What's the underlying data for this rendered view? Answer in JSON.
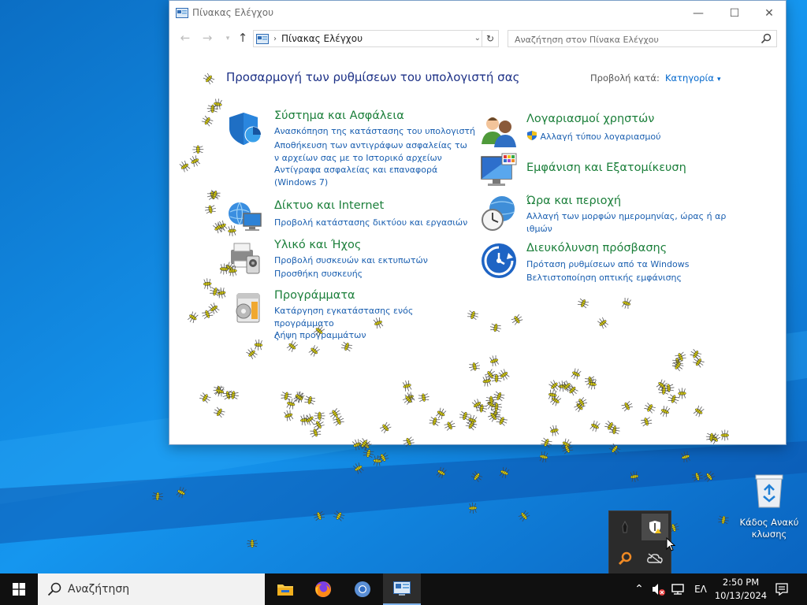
{
  "window": {
    "title": "Πίνακας Ελέγχου",
    "minimize": "—",
    "maximize": "☐",
    "close": "✕"
  },
  "nav": {
    "back": "←",
    "forward": "→",
    "recent": "▾",
    "up": "↑",
    "address_separator": "›",
    "address_text": "Πίνακας Ελέγχου",
    "address_dropdown": "⌄",
    "refresh": "↻",
    "search_placeholder": "Αναζήτηση στον Πίνακα Ελέγχου"
  },
  "content": {
    "heading": "Προσαρμογή των ρυθμίσεων του υπολογιστή σας",
    "view_by_label": "Προβολή κατά:",
    "view_by_value": "Κατηγορία",
    "view_by_caret": "▾"
  },
  "categories_left": [
    {
      "title": "Σύστημα και Ασφάλεια",
      "icon": "shield-icon",
      "links": [
        "Ανασκόπηση της κατάστασης του υπολογιστή",
        "Αποθήκευση των αντιγράφων ασφαλείας τω\nν αρχείων σας με το Ιστορικό αρχείων",
        "Αντίγραφα ασφαλείας και επαναφορά\n(Windows 7)"
      ]
    },
    {
      "title": "Δίκτυο και Internet",
      "icon": "network-icon",
      "links": [
        "Προβολή κατάστασης δικτύου και εργασιών"
      ]
    },
    {
      "title": "Υλικό και Ήχος",
      "icon": "printer-icon",
      "links": [
        "Προβολή συσκευών και εκτυπωτών",
        "Προσθήκη συσκευής"
      ]
    },
    {
      "title": "Προγράμματα",
      "icon": "programs-icon",
      "links": [
        "Κατάργηση εγκατάστασης ενός προγράμματο\nς",
        "Λήψη προγραμμάτων"
      ]
    }
  ],
  "categories_right": [
    {
      "title": "Λογαριασμοί χρηστών",
      "icon": "users-icon",
      "links": [
        "Αλλαγή τύπου λογαριασμού"
      ]
    },
    {
      "title": "Εμφάνιση και Εξατομίκευση",
      "icon": "display-icon",
      "links": []
    },
    {
      "title": "Ώρα και περιοχή",
      "icon": "clock-globe-icon",
      "links": [
        "Αλλαγή των μορφών ημερομηνίας, ώρας ή αρ\nιθμών"
      ]
    },
    {
      "title": "Διευκόλυνση πρόσβασης",
      "icon": "accessibility-icon",
      "links": [
        "Πρόταση ρυθμίσεων από τα Windows",
        "Βελτιστοποίηση οπτικής εμφάνισης"
      ]
    }
  ],
  "desktop": {
    "recycle_bin_label": "Κάδος Ανακύ\nκλωσης"
  },
  "taskbar": {
    "search_placeholder": "Αναζήτηση",
    "apps": [
      "file-explorer-icon",
      "firefox-icon",
      "chromium-icon",
      "control-panel-icon"
    ],
    "language": "ΕΛ",
    "time": "2:50 PM",
    "date": "10/13/2024",
    "tray_chevron": "⌃"
  },
  "colors": {
    "heading": "#1e3287",
    "category_title": "#1b7f3a",
    "link": "#1a5fb0",
    "ant": "#e5d900"
  }
}
